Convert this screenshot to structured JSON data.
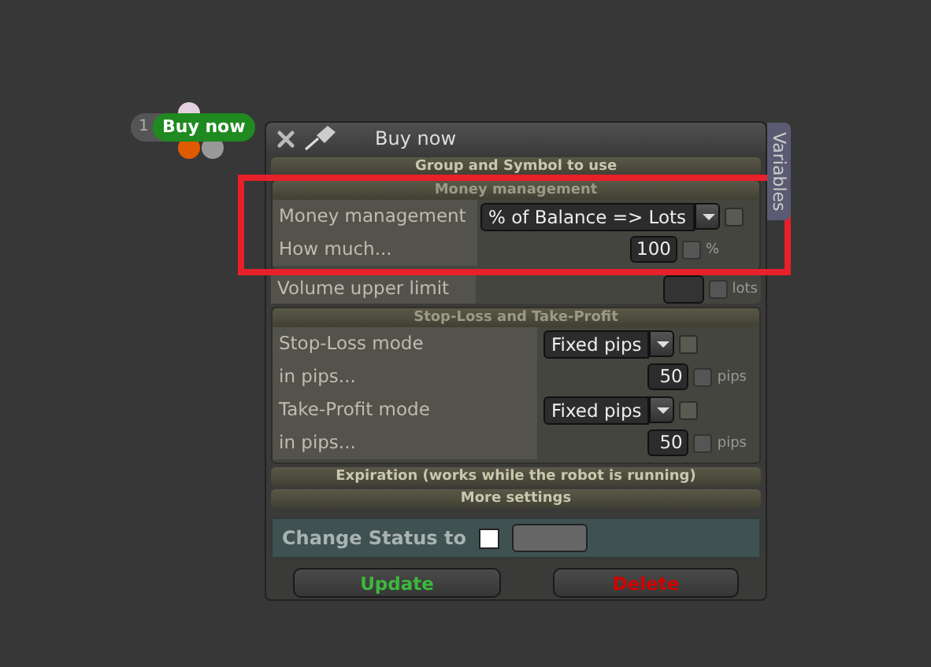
{
  "node": {
    "number": "1",
    "label": "Buy now"
  },
  "window": {
    "title": "Buy now",
    "side_tab": "Variables"
  },
  "sections": [
    {
      "kind": "header",
      "title": "Group and Symbol to use"
    },
    {
      "kind": "panel",
      "title": "Money management",
      "highlighted": true,
      "groups": [
        [
          {
            "label": "Money management",
            "kind": "select",
            "value": "% of Balance => Lots",
            "checked": false
          },
          {
            "label": "How much...",
            "kind": "input",
            "value": "100",
            "unit": "%",
            "checked": false
          }
        ]
      ]
    },
    {
      "kind": "row",
      "row": {
        "label": "Volume upper limit",
        "kind": "input",
        "unit": "lots",
        "checked": false
      }
    },
    {
      "kind": "panel",
      "title": "Stop-Loss and Take-Profit",
      "highlighted": false,
      "groups": [
        [
          {
            "label": "Stop-Loss mode",
            "kind": "select",
            "value": "Fixed pips",
            "checked": false
          },
          {
            "label": "in pips...",
            "kind": "input",
            "value": "50",
            "unit": "pips",
            "checked": false
          }
        ],
        [
          {
            "label": "Take-Profit mode",
            "kind": "select",
            "value": "Fixed pips",
            "checked": false
          },
          {
            "label": "in pips...",
            "kind": "input",
            "value": "50",
            "unit": "pips",
            "checked": false
          }
        ]
      ]
    },
    {
      "kind": "header",
      "title": "Expiration (works while the robot is running)"
    },
    {
      "kind": "header",
      "title": "More settings"
    }
  ],
  "status": {
    "label": "Change Status to",
    "checked": false
  },
  "buttons": [
    {
      "label": "Update",
      "kind": "update"
    },
    {
      "label": "Delete",
      "kind": "delete"
    }
  ]
}
